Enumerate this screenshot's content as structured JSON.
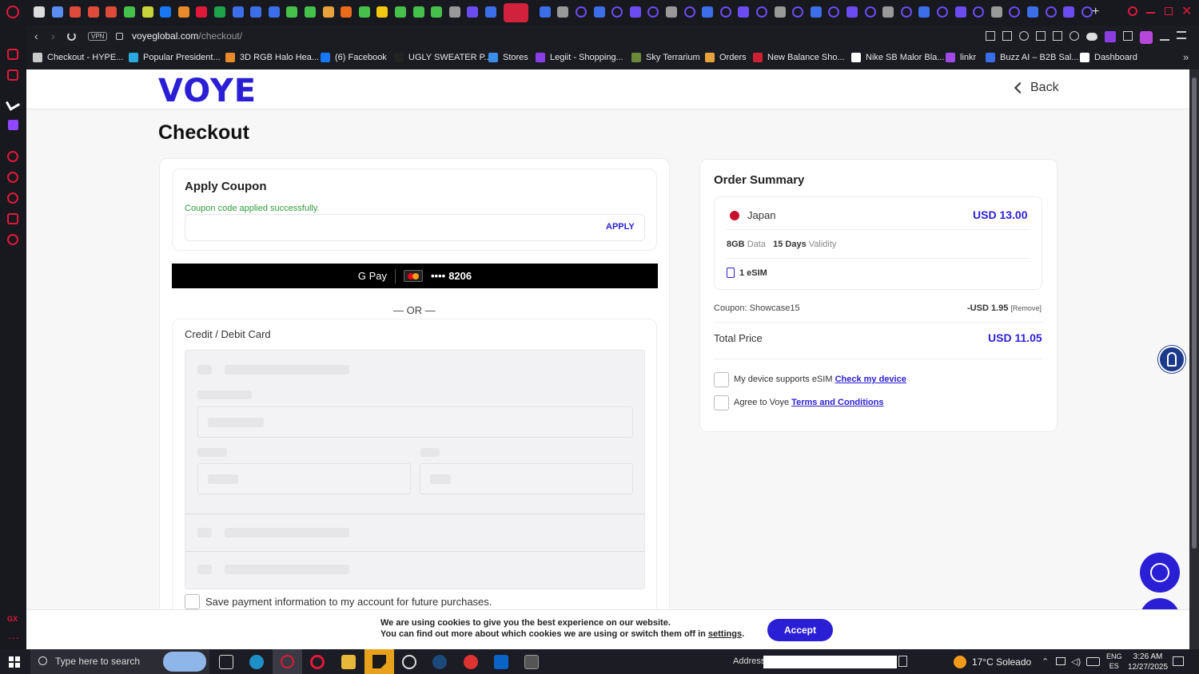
{
  "browser": {
    "url_host": "voyeglobal.com",
    "url_path": "/checkout/",
    "vpn_label": "VPN"
  },
  "bookmarks": [
    {
      "label": "Checkout - HYPE...",
      "color": "#c9c9c9"
    },
    {
      "label": "Popular President...",
      "color": "#2aa8e0"
    },
    {
      "label": "3D RGB Halo Hea...",
      "color": "#e88a2a"
    },
    {
      "label": "(6) Facebook",
      "color": "#1877f2"
    },
    {
      "label": "UGLY SWEATER P...",
      "color": "#222"
    },
    {
      "label": "Stores",
      "color": "#3b8ee8"
    },
    {
      "label": "Legiit - Shopping...",
      "color": "#8a3ee8"
    },
    {
      "label": "Sky Terrarium",
      "color": "#6a8a3a"
    },
    {
      "label": "Orders",
      "color": "#e8a23b"
    },
    {
      "label": "New Balance Sho...",
      "color": "#cc2233"
    },
    {
      "label": "Nike SB Malor Bla...",
      "color": "#ffffff"
    },
    {
      "label": "linkr",
      "color": "#a04ae8"
    },
    {
      "label": "Buzz AI – B2B Sal...",
      "color": "#3a6ee8"
    },
    {
      "label": "Dashboard",
      "color": "#ffffff"
    }
  ],
  "site": {
    "logo": "VOYE",
    "back_label": "Back",
    "page_title": "Checkout"
  },
  "coupon": {
    "title": "Apply Coupon",
    "success_msg": "Coupon code applied successfully.",
    "input_value": "",
    "apply_label": "APPLY"
  },
  "gpay": {
    "label": "G Pay",
    "card_dots": "••••",
    "card_last4": "8206"
  },
  "or_divider": "— OR —",
  "card_form": {
    "title": "Credit / Debit Card",
    "save_label": "Save payment information to my account for future purchases."
  },
  "order_summary": {
    "title": "Order Summary",
    "country": "Japan",
    "price": "USD 13.00",
    "data_amount": "8GB",
    "data_label": "Data",
    "days_amount": "15 Days",
    "validity_label": "Validity",
    "esim_label": "1 eSIM",
    "coupon_label": "Coupon: Showcase15",
    "discount": "-USD 1.95",
    "remove_label": "[Remove]",
    "total_label": "Total Price",
    "total_value": "USD 11.05",
    "device_text": "My device supports eSIM",
    "device_link": "Check my device",
    "agree_text": "Agree to Voye",
    "terms_link": "Terms and Conditions"
  },
  "cookie": {
    "line1": "We are using cookies to give you the best experience on our website.",
    "line2": "You can find out more about which cookies we are using or switch them off in",
    "settings_link": "settings",
    "period": ".",
    "accept_label": "Accept"
  },
  "taskbar": {
    "search_placeholder": "Type here to search",
    "address_label": "Address",
    "weather": "17°C  Soleado",
    "lang1": "ENG",
    "lang2": "ES",
    "time": "3:26 AM",
    "date": "12/27/2025"
  },
  "colors": {
    "brand": "#2b1fd6",
    "success": "#2e9c3a",
    "japan_dot": "#c8102e"
  }
}
